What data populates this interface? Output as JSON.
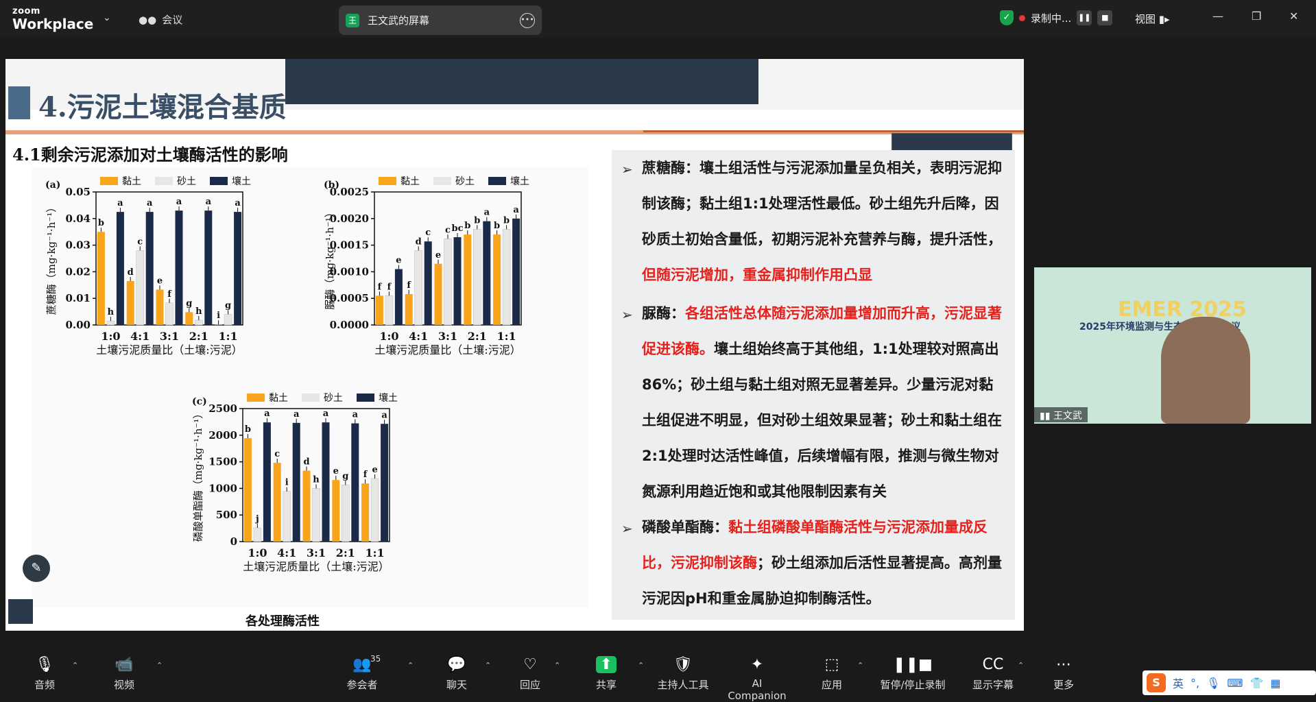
{
  "topbar": {
    "logo_line1": "zoom",
    "logo_line2": "Workplace",
    "meeting": "会议",
    "share_title": "王文武的屏幕",
    "share_tag": "王",
    "recording": "录制中...",
    "view": "视图"
  },
  "slide": {
    "title": "4.污泥土壤混合基质",
    "subtitle": "4.1剩余污泥添加对土壤酶活性的影响",
    "caption": "各处理酶活性",
    "legend": [
      "黏土",
      "砂土",
      "壤土"
    ],
    "colors": {
      "clay": "#f8a51c",
      "sand": "#e6e6e6",
      "loam": "#1b2a48"
    },
    "xlabel": "土壤污泥质量比（土壤:污泥）",
    "bullets": [
      {
        "runs": [
          [
            "蔗糖酶：壤土组活性与污泥添加量呈负相关，表明污泥抑制该酶；黏土组1:1处理活性最低。砂土组先升后降，因砂质土初始含量低，初期污泥补充营养与酶，提升活性，",
            ""
          ],
          [
            "但随污泥增加，重金属抑制作用凸显",
            "red"
          ]
        ]
      },
      {
        "runs": [
          [
            "脲酶：",
            ""
          ],
          [
            "各组活性总体随污泥添加量增加而升高，污泥显著促进该酶。",
            "red"
          ],
          [
            "壤土组始终高于其他组，1:1处理较对照高出86%；砂土组与黏土组对照无显著差异。少量污泥对黏土组促进不明显，但对砂土组效果显著；砂土和黏土组在2:1处理时达活性峰值，后续增幅有限，推测与微生物对氮源利用趋近饱和或其他限制因素有关",
            ""
          ]
        ]
      },
      {
        "runs": [
          [
            "磷酸单酯酶：",
            ""
          ],
          [
            "黏土组磷酸单酯酶活性与污泥添加量成反比，污泥抑制该酶",
            "red"
          ],
          [
            "；砂土组添加后活性显著提高。高剂量污泥因pH和重金属胁迫抑制酶活性。",
            ""
          ]
        ]
      }
    ]
  },
  "chart_data": [
    {
      "type": "bar",
      "panel": "(a)",
      "ylabel": "蔗糖酶（mg·kg⁻¹·h⁻¹）",
      "categories": [
        "1:0",
        "4:1",
        "3:1",
        "2:1",
        "1:1"
      ],
      "ylim": [
        0,
        0.05
      ],
      "yticks": [
        "0.00",
        "0.01",
        "0.02",
        "0.03",
        "0.04",
        "0.05"
      ],
      "series": [
        {
          "name": "黏土",
          "values": [
            0.035,
            0.0165,
            0.0133,
            0.0048,
            0.0002
          ],
          "letters": [
            "b",
            "d",
            "e",
            "g",
            "i"
          ]
        },
        {
          "name": "砂土",
          "values": [
            0.0015,
            0.028,
            0.0083,
            0.0018,
            0.004
          ],
          "letters": [
            "h",
            "c",
            "f",
            "h",
            "g"
          ]
        },
        {
          "name": "壤土",
          "values": [
            0.0425,
            0.0425,
            0.043,
            0.043,
            0.0425
          ],
          "letters": [
            "a",
            "a",
            "a",
            "a",
            "a"
          ]
        }
      ]
    },
    {
      "type": "bar",
      "panel": "(b)",
      "ylabel": "脲酶（mg·kg⁻¹·h⁻¹）",
      "categories": [
        "1:0",
        "4:1",
        "3:1",
        "2:1",
        "1:1"
      ],
      "ylim": [
        0,
        0.0025
      ],
      "yticks": [
        "0.0000",
        "0.0005",
        "0.0010",
        "0.0015",
        "0.0020",
        "0.0025"
      ],
      "series": [
        {
          "name": "黏土",
          "values": [
            0.00055,
            0.00058,
            0.00115,
            0.0017,
            0.0017
          ],
          "letters": [
            "f",
            "f",
            "e",
            "b",
            "b"
          ]
        },
        {
          "name": "砂土",
          "values": [
            0.00055,
            0.0014,
            0.00162,
            0.0018,
            0.0018
          ],
          "letters": [
            "f",
            "d",
            "c",
            "b",
            "b"
          ]
        },
        {
          "name": "壤土",
          "values": [
            0.00105,
            0.00157,
            0.00165,
            0.00195,
            0.002
          ],
          "letters": [
            "e",
            "c",
            "bc",
            "a",
            "a"
          ]
        }
      ]
    },
    {
      "type": "bar",
      "panel": "(c)",
      "ylabel": "磷酸单酯酶（mg·kg⁻¹·h⁻¹）",
      "categories": [
        "1:0",
        "4:1",
        "3:1",
        "2:1",
        "1:1"
      ],
      "ylim": [
        0,
        2700
      ],
      "yticks": [
        "0",
        "500",
        "1000",
        "1500",
        "2000",
        "2500"
      ],
      "series": [
        {
          "name": "黏土",
          "values": [
            2100,
            1600,
            1440,
            1250,
            1180
          ],
          "letters": [
            "b",
            "c",
            "d",
            "e",
            "f"
          ]
        },
        {
          "name": "砂土",
          "values": [
            280,
            1020,
            1080,
            1150,
            1280
          ],
          "letters": [
            "j",
            "i",
            "h",
            "g",
            "e"
          ]
        },
        {
          "name": "壤土",
          "values": [
            2420,
            2410,
            2420,
            2400,
            2390
          ],
          "letters": [
            "a",
            "a",
            "a",
            "a",
            "a"
          ]
        }
      ]
    }
  ],
  "video": {
    "title": "EMER 2025",
    "subtitle": "2025年环境监测与生态修复学术会议",
    "name": "王文武"
  },
  "bottombar": {
    "items": [
      {
        "icon": "mic-muted-icon",
        "label": "音频"
      },
      {
        "icon": "video-muted-icon",
        "label": "视频"
      },
      {
        "icon": "participants-icon",
        "label": "参会者",
        "badge": "35"
      },
      {
        "icon": "chat-icon",
        "label": "聊天"
      },
      {
        "icon": "reactions-icon",
        "label": "回应"
      },
      {
        "icon": "share-icon",
        "label": "共享"
      },
      {
        "icon": "host-tools-icon",
        "label": "主持人工具"
      },
      {
        "icon": "ai-companion-icon",
        "label": "AI Companion"
      },
      {
        "icon": "apps-icon",
        "label": "应用"
      },
      {
        "icon": "pause-stop-recording-icon",
        "label": "暂停/停止录制"
      },
      {
        "icon": "captions-icon",
        "label": "显示字幕"
      },
      {
        "icon": "more-icon",
        "label": "更多"
      }
    ]
  },
  "ime": {
    "lang": "英"
  }
}
